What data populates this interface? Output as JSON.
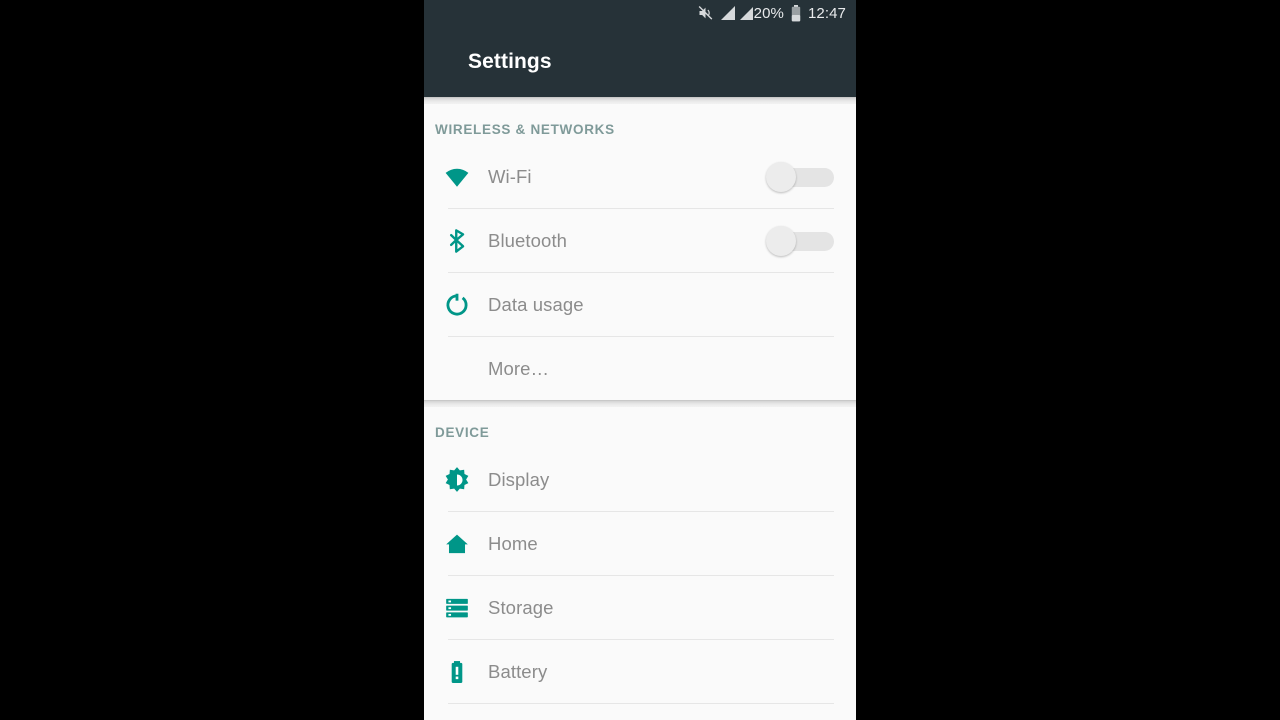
{
  "statusbar": {
    "mute_icon": "volume-mute-icon",
    "signal1_icon": "signal-bars-icon",
    "signal2_icon": "signal-bars-icon",
    "battery_percent": "20%",
    "battery_icon": "battery-icon",
    "time": "12:47"
  },
  "appbar": {
    "title": "Settings"
  },
  "colors": {
    "accent_teal": "#009688",
    "appbar_background": "#263238",
    "section_header": "#7f9a99",
    "row_label": "#8c8c8c",
    "card_background": "#fafafa"
  },
  "sections": [
    {
      "header": "WIRELESS & NETWORKS",
      "rows": [
        {
          "label": "Wi-Fi",
          "icon": "wifi-icon",
          "toggle": "off"
        },
        {
          "label": "Bluetooth",
          "icon": "bluetooth-icon",
          "toggle": "off"
        },
        {
          "label": "Data usage",
          "icon": "data-usage-icon"
        },
        {
          "label": "More…",
          "icon": null
        }
      ]
    },
    {
      "header": "DEVICE",
      "rows": [
        {
          "label": "Display",
          "icon": "brightness-icon"
        },
        {
          "label": "Home",
          "icon": "home-icon"
        },
        {
          "label": "Storage",
          "icon": "storage-icon"
        },
        {
          "label": "Battery",
          "icon": "battery-icon"
        }
      ]
    }
  ]
}
